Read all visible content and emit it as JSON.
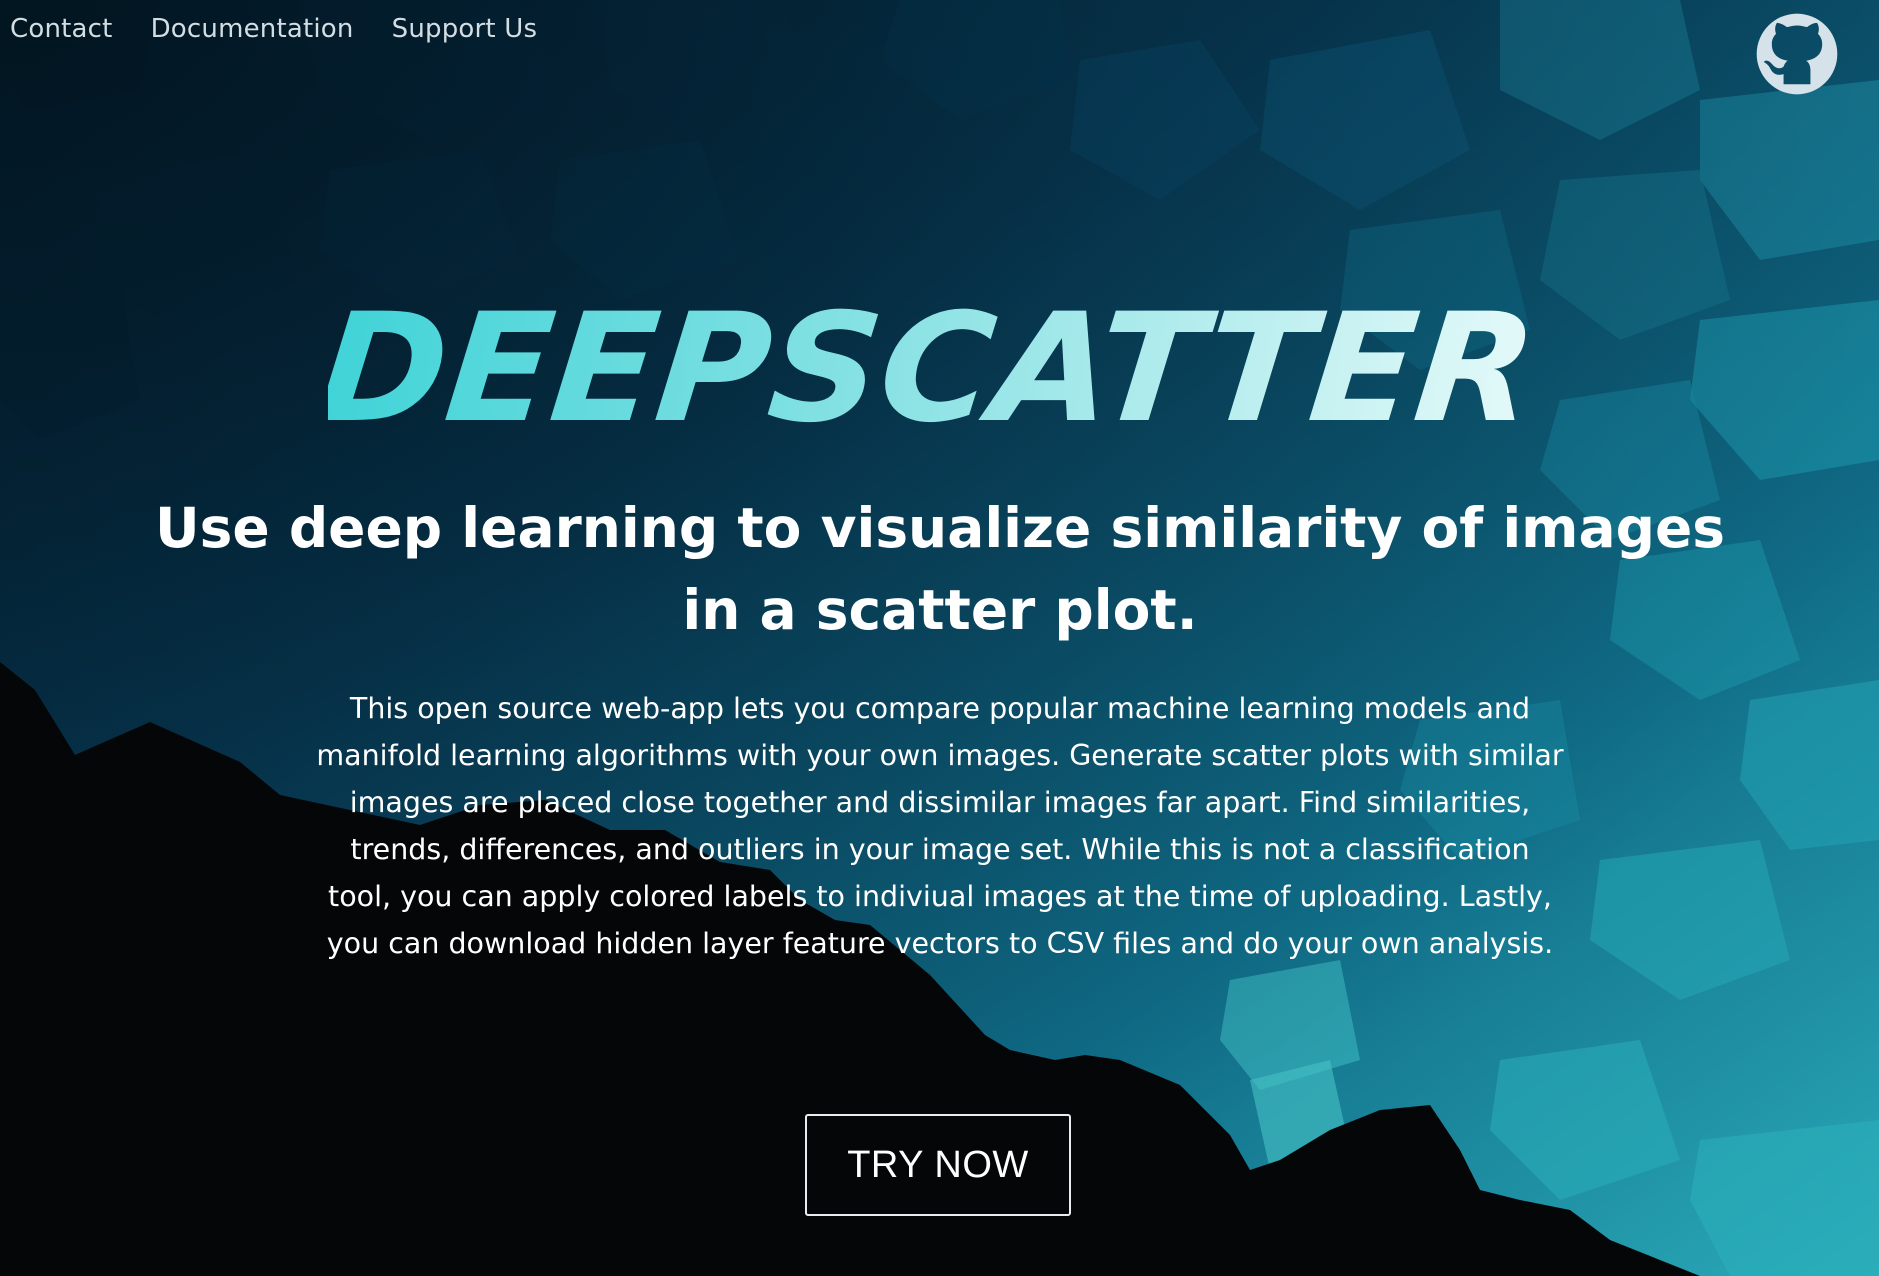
{
  "nav": {
    "items": [
      {
        "label": "Contact"
      },
      {
        "label": "Documentation"
      },
      {
        "label": "Support Us"
      }
    ]
  },
  "header": {
    "github_icon": "github-icon"
  },
  "hero": {
    "logo_text": "DEEPSCATTER",
    "headline": "Use deep learning to visualize similarity of images in a scatter plot.",
    "description": "This open source web-app lets you compare popular machine learning models and manifold learning algorithms with your own images. Generate scatter plots with similar images are placed close together and dissimilar images far apart. Find similarities, trends, differences, and outliers in your image set. While this is not a classification tool, you can apply colored labels to indiviual images at the time of uploading. Lastly, you can download hidden layer feature vectors to CSV files and do your own analysis.",
    "cta_label": "TRY NOW"
  },
  "colors": {
    "bg_dark": "#04080c",
    "bg_teal_dark": "#062f47",
    "bg_teal_light": "#25a4b2",
    "logo_start": "#3fd3d7",
    "logo_end": "#e4f9f9",
    "nav_text": "#d3dde2"
  }
}
